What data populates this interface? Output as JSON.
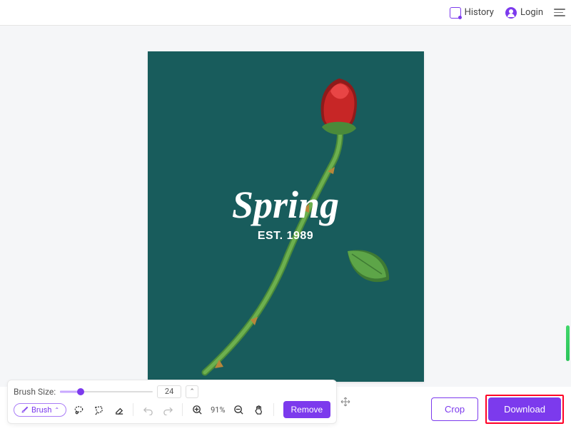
{
  "header": {
    "history": "History",
    "login": "Login"
  },
  "artboard": {
    "title": "Spring",
    "subtitle": "EST. 1989"
  },
  "tools": {
    "brush_size_label": "Brush Size:",
    "brush_size_value": "24",
    "brush_button": "Brush",
    "zoom_level": "91%",
    "remove": "Remove"
  },
  "actions": {
    "crop": "Crop",
    "download": "Download"
  },
  "colors": {
    "accent": "#7c3aed",
    "artboard_bg": "#185c5c",
    "highlight": "#ff0026"
  }
}
